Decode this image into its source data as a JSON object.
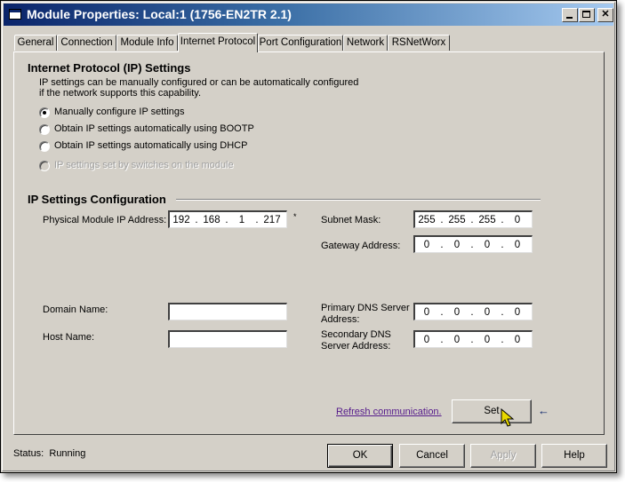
{
  "window": {
    "title": "Module Properties: Local:1 (1756-EN2TR 2.1)",
    "controls": {
      "minimize": "_",
      "maximize": "□",
      "close": "✕"
    }
  },
  "tabs": [
    {
      "label": "General",
      "active": false
    },
    {
      "label": "Connection",
      "active": false
    },
    {
      "label": "Module Info",
      "active": false
    },
    {
      "label": "Internet Protocol",
      "active": true
    },
    {
      "label": "Port Configuration",
      "active": false
    },
    {
      "label": "Network",
      "active": false
    },
    {
      "label": "RSNetWorx",
      "active": false
    }
  ],
  "ip_settings": {
    "heading": "Internet Protocol (IP) Settings",
    "description_line1": "IP settings can be manually configured or can be automatically configured",
    "description_line2": "if the network supports this capability.",
    "options": [
      {
        "label": "Manually configure IP settings",
        "checked": true,
        "disabled": false
      },
      {
        "label": "Obtain IP settings automatically using BOOTP",
        "checked": false,
        "disabled": false
      },
      {
        "label": "Obtain IP settings automatically using DHCP",
        "checked": false,
        "disabled": false
      },
      {
        "label": "IP settings set by switches on the module",
        "checked": false,
        "disabled": true
      }
    ]
  },
  "ip_config": {
    "heading": "IP Settings Configuration",
    "physical_ip": {
      "label": "Physical Module IP Address:",
      "octets": [
        "192",
        "168",
        "1",
        "217"
      ],
      "marker": "*"
    },
    "subnet_mask": {
      "label": "Subnet Mask:",
      "octets": [
        "255",
        "255",
        "255",
        "0"
      ]
    },
    "gateway": {
      "label": "Gateway Address:",
      "octets": [
        "0",
        "0",
        "0",
        "0"
      ]
    },
    "domain_name": {
      "label": "Domain Name:",
      "value": ""
    },
    "host_name": {
      "label": "Host Name:",
      "value": ""
    },
    "primary_dns": {
      "label_line1": "Primary DNS Server",
      "label_line2": "Address:",
      "octets": [
        "0",
        "0",
        "0",
        "0"
      ]
    },
    "secondary_dns": {
      "label_line1": "Secondary DNS",
      "label_line2": "Server Address:",
      "octets": [
        "0",
        "0",
        "0",
        "0"
      ]
    }
  },
  "refresh_link": "Refresh communication.",
  "set_button": "Set",
  "footer": {
    "status_label": "Status:",
    "status_value": "Running",
    "ok": "OK",
    "cancel": "Cancel",
    "apply": "Apply",
    "help": "Help"
  }
}
